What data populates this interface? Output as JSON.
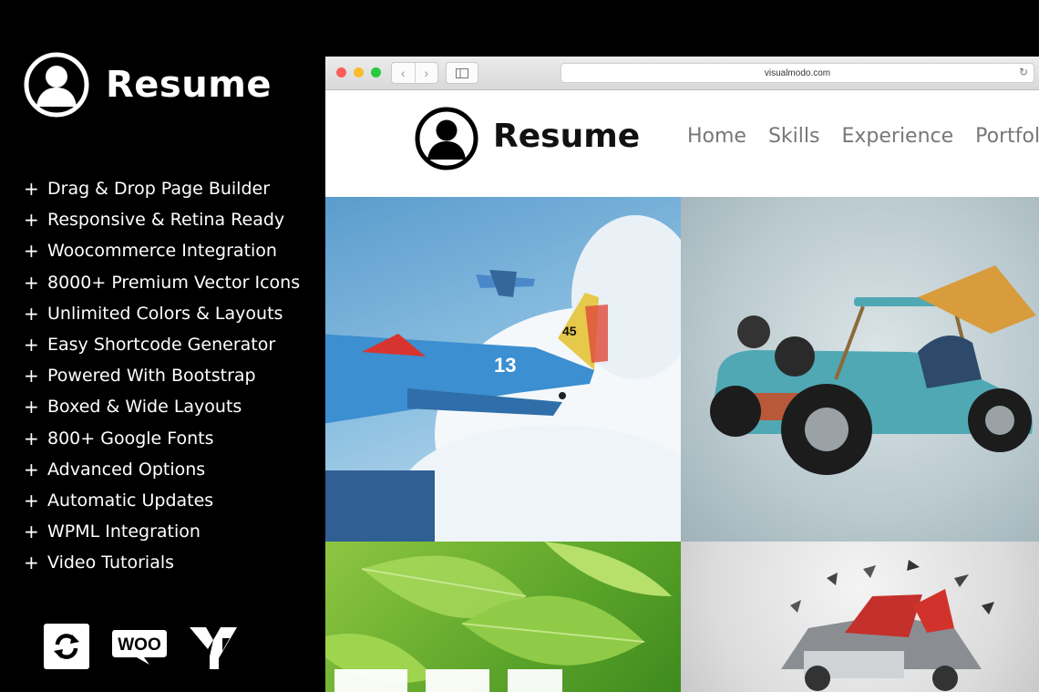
{
  "promo": {
    "title": "Resume",
    "features": [
      "Drag & Drop Page Builder",
      "Responsive & Retina Ready",
      "Woocommerce Integration",
      "8000+ Premium Vector Icons",
      "Unlimited Colors & Layouts",
      "Easy Shortcode Generator",
      "Powered With Bootstrap",
      "Boxed & Wide Layouts",
      "800+ Google Fonts",
      "Advanced Options",
      "Automatic Updates",
      "WPML Integration",
      "Video Tutorials"
    ],
    "plus_symbol": "+",
    "badges": {
      "woo_label": "WOO"
    }
  },
  "browser": {
    "url": "visualmodo.com",
    "traffic_colors": {
      "red": "#fc5f57",
      "yellow": "#fdbc2e",
      "green": "#28c840"
    }
  },
  "site": {
    "title": "Resume",
    "nav": [
      "Home",
      "Skills",
      "Experience",
      "Portfolio"
    ]
  },
  "tiles": [
    "airplane-photo",
    "vintage-car-photo",
    "green-leaves-photo",
    "exploding-truck-photo"
  ]
}
